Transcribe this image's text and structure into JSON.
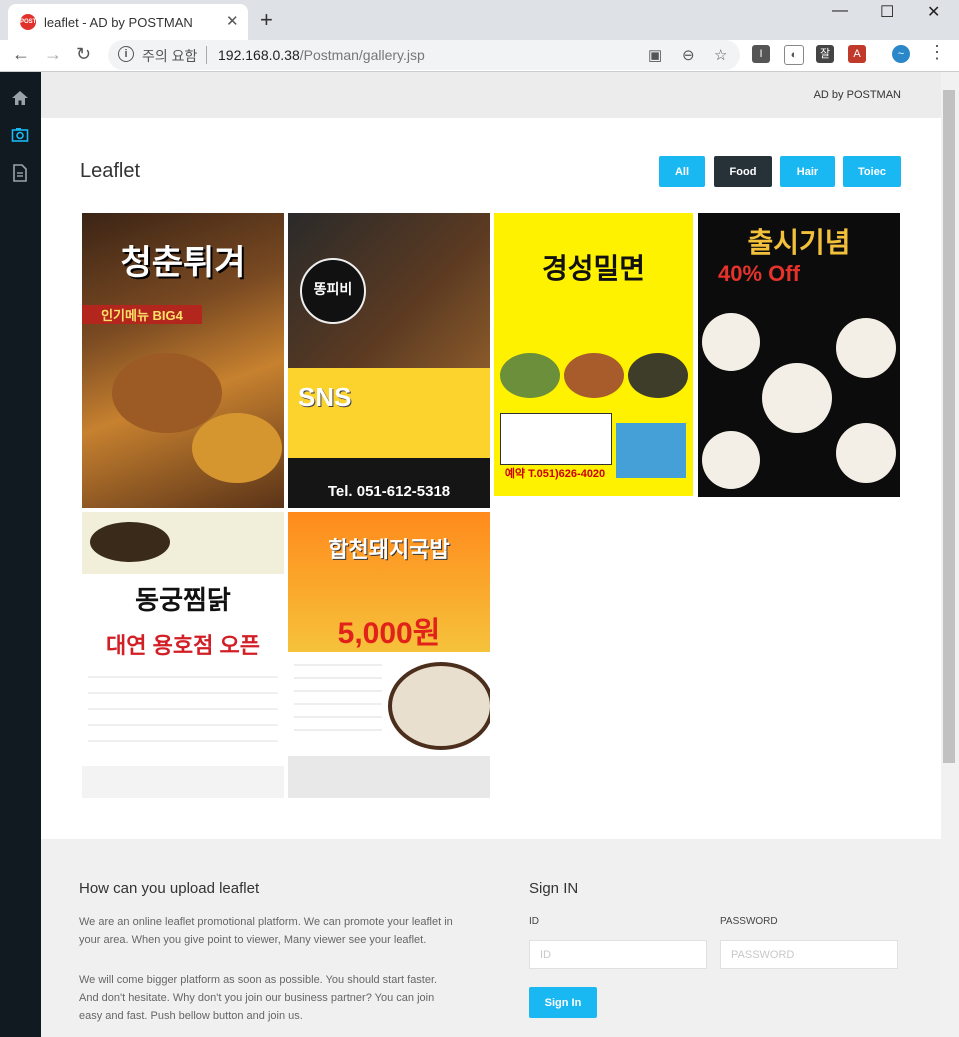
{
  "browser": {
    "tab_title": "leaflet - AD by POSTMAN",
    "favicon_text": "POST",
    "url_warning": "주의 요함",
    "url_host": "192.168.0.38",
    "url_path": "/Postman/gallery.jsp",
    "extensions": [
      "I",
      "잘"
    ]
  },
  "header": {
    "brand": "AD by POSTMAN"
  },
  "gallery": {
    "title": "Leaflet",
    "filters": [
      "All",
      "Food",
      "Hair",
      "Toiec"
    ],
    "active_filter": "Food",
    "leaflets": [
      {
        "caption": "청춘튀겨",
        "sub": "인기메뉴 BIG4"
      },
      {
        "caption": "똥피비",
        "sub": "Tel. 051-612-5318"
      },
      {
        "caption": "경성밀면",
        "sub": "예약 T.051)626-4020"
      },
      {
        "caption": "출시기념",
        "sub": "40% Off"
      },
      {
        "caption": "동궁찜닭",
        "sub": "대연 용호점 오픈"
      },
      {
        "caption": "합천돼지국밥",
        "sub": "5,000원"
      }
    ]
  },
  "footer": {
    "upload_title": "How can you upload leaflet",
    "upload_text1": "We are an online leaflet promotional platform. We can promote your leaflet in your area. When you give point to viewer, Many viewer see your leaflet.",
    "upload_text2": "We will come bigger platform as soon as possible. You should start faster. And don't hesitate. Why don't you join our business partner? You can join easy and fast. Push bellow button and join us.",
    "signin_title": "Sign IN",
    "id_label": "ID",
    "password_label": "PASSWORD",
    "id_placeholder": "ID",
    "password_placeholder": "PASSWORD",
    "signin_button": "Sign In"
  },
  "colors": {
    "accent": "#1ab8f3",
    "active": "#263238",
    "sidebar": "#121a21"
  }
}
